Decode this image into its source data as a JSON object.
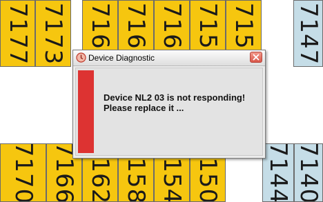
{
  "top_row": [
    "7177",
    "7173",
    "7169",
    "7165",
    "7161",
    "7157",
    "7153"
  ],
  "top_right_tile": "7147",
  "bottom_row": [
    "7170",
    "7166",
    "7162",
    "7158",
    "7154",
    "7150"
  ],
  "bottom_right_tiles": [
    "7144",
    "7140"
  ],
  "colors": {
    "tile_yellow": "#f6c60f",
    "tile_blue": "#c5dde7",
    "alert_red": "#dd3332"
  },
  "dialog": {
    "title": "Device Diagnostic",
    "title_icon": "warning-icon",
    "close_icon": "close-icon",
    "message_line1": "Device NL2 03 is not responding!",
    "message_line2": "Please replace it ..."
  }
}
